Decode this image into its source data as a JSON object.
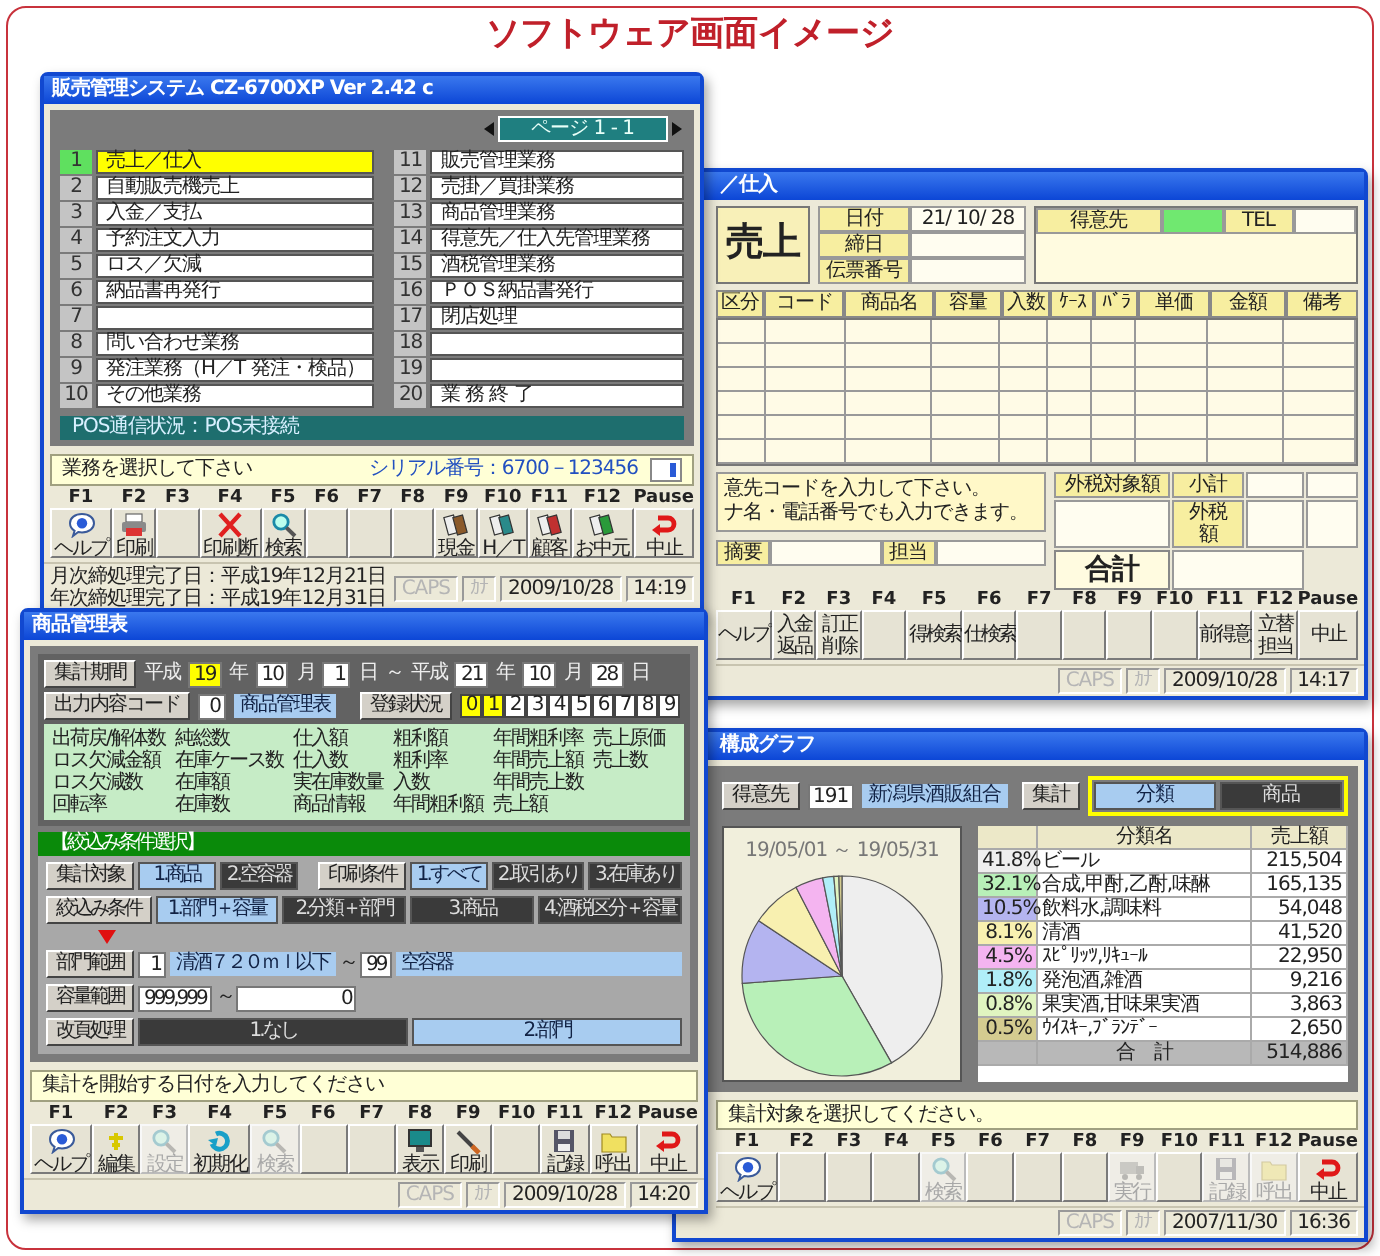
{
  "heading": "ソフトウェア画面イメージ",
  "windows": [
    {
      "kind": "menu",
      "title": "販売管理システム CZ-6700XP Ver 2.42 c",
      "page": "ページ 1 - 1",
      "items": [
        {
          "number": "1",
          "label": "売上／仕入",
          "selected": true
        },
        {
          "number": "2",
          "label": "自動販売機売上",
          "selected": false
        },
        {
          "number": "3",
          "label": "入金／支払",
          "selected": false
        },
        {
          "number": "4",
          "label": "予約注文入力",
          "selected": false
        },
        {
          "number": "5",
          "label": "ロス／欠減",
          "selected": false
        },
        {
          "number": "6",
          "label": "納品書再発行",
          "selected": false
        },
        {
          "number": "7",
          "selected": false
        },
        {
          "number": "8",
          "label": "問い合わせ業務",
          "selected": false
        },
        {
          "number": "9",
          "label": "発注業務（H／T 発注・検品）",
          "selected": false
        },
        {
          "number": "10",
          "label": "その他業務",
          "selected": false
        },
        {
          "number": "11",
          "label": "販売管理業務",
          "selected": false
        },
        {
          "number": "12",
          "label": "売掛／買掛業務",
          "selected": false
        },
        {
          "number": "13",
          "label": "商品管理業務",
          "selected": false
        },
        {
          "number": "14",
          "label": "得意先／仕入先管理業務",
          "selected": false
        },
        {
          "number": "15",
          "label": "酒税管理業務",
          "selected": false
        },
        {
          "number": "16",
          "label": "ＰＯＳ納品書発行",
          "selected": false
        },
        {
          "number": "17",
          "label": "閉店処理",
          "selected": false
        },
        {
          "number": "18",
          "selected": false
        },
        {
          "number": "19",
          "selected": false
        },
        {
          "number": "20",
          "label": "業 務 終 了",
          "selected": false
        }
      ],
      "pos_status": "POS通信状況：POS未接続",
      "prompt": "業務を選択して下さい",
      "serial": "シリアル番号：6700－123456",
      "fkeys": [
        {
          "key": "F1",
          "label": "ヘルプ",
          "kind": "help"
        },
        {
          "key": "F2",
          "label": "印刷",
          "kind": "print"
        },
        {
          "key": "F3"
        },
        {
          "key": "F4",
          "label": "印刷断",
          "kind": "cancel"
        },
        {
          "key": "F5",
          "label": "検索",
          "kind": "search"
        },
        {
          "key": "F6"
        },
        {
          "key": "F7"
        },
        {
          "key": "F8"
        },
        {
          "key": "F9",
          "label": "現金",
          "kind": "card",
          "color": "#8b5a2b"
        },
        {
          "key": "F10",
          "label": "H／T",
          "kind": "card",
          "color": "#2a8a8a"
        },
        {
          "key": "F11",
          "label": "顧客",
          "kind": "card",
          "color": "#c03030"
        },
        {
          "key": "F12",
          "label": "お中元",
          "kind": "card",
          "color": "#2a9a3a"
        },
        {
          "key": "Pause",
          "label": "中止",
          "kind": "stop"
        }
      ],
      "status_bar": {
        "messages": [
          "月次締処理完了日：平成19年12月21日",
          "年次締処理完了日：平成19年12月31日"
        ],
        "indicators": [
          {
            "text": "CAPS",
            "on": false
          },
          {
            "text": "ｶﾅ",
            "on": false
          },
          {
            "text": "2009/10/28",
            "on": true
          },
          {
            "text": "14:19",
            "on": true
          }
        ]
      }
    },
    {
      "kind": "sales",
      "title": "／仕入",
      "mode": "売上",
      "slip_fields": [
        {
          "label": "日付",
          "value": "21/ 10/ 28"
        },
        {
          "label": "締日"
        },
        {
          "label": "伝票番号"
        }
      ],
      "customer": {
        "label": "得意先",
        "focused": true,
        "tel_label": "TEL"
      },
      "columns": [
        "区分",
        "コード",
        "商品名",
        "容量",
        "入数",
        "ｹｰｽ",
        "ﾊﾞﾗ",
        "単価",
        "金額",
        "備考"
      ],
      "message": [
        "意先コードを入力して下さい。",
        "ナ名・電話番号でも入力できます。"
      ],
      "taxable_label": "外税対象額",
      "subtotal_label": "小計",
      "tax_label": "外税額",
      "total_label": "合計",
      "memo_label": "摘要",
      "staff_label": "担当",
      "fkeys": [
        {
          "key": "F1",
          "lines": [
            "ヘルプ"
          ]
        },
        {
          "key": "F2",
          "lines": [
            "入金",
            "返品"
          ]
        },
        {
          "key": "F3",
          "lines": [
            "訂正",
            "削除"
          ]
        },
        {
          "key": "F4"
        },
        {
          "key": "F5",
          "lines": [
            "得検索"
          ]
        },
        {
          "key": "F6",
          "lines": [
            "仕検索"
          ]
        },
        {
          "key": "F7"
        },
        {
          "key": "F8"
        },
        {
          "key": "F9"
        },
        {
          "key": "F10"
        },
        {
          "key": "F11",
          "lines": [
            "前得意"
          ]
        },
        {
          "key": "F12",
          "lines": [
            "立替",
            "担当"
          ]
        },
        {
          "key": "Pause",
          "lines": [
            "中止"
          ]
        }
      ],
      "status_bar": {
        "indicators": [
          {
            "text": "CAPS",
            "on": false
          },
          {
            "text": "ｶﾅ",
            "on": false
          },
          {
            "text": "2009/10/28",
            "on": true
          },
          {
            "text": "14:17",
            "on": true
          }
        ]
      }
    },
    {
      "kind": "report",
      "title": "商品管理表",
      "period": {
        "button": "集計期間",
        "parts": [
          {
            "kind": "text",
            "text": "平成"
          },
          {
            "kind": "field",
            "value": "19",
            "focused": true
          },
          {
            "kind": "text",
            "text": "年"
          },
          {
            "kind": "field",
            "value": "10",
            "focused": false
          },
          {
            "kind": "text",
            "text": "月"
          },
          {
            "kind": "field",
            "value": "1",
            "focused": false
          },
          {
            "kind": "text",
            "text": "日"
          },
          {
            "kind": "text",
            "text": "～"
          },
          {
            "kind": "text",
            "text": "平成"
          },
          {
            "kind": "field",
            "value": "21",
            "focused": false
          },
          {
            "kind": "text",
            "text": "年"
          },
          {
            "kind": "field",
            "value": "10",
            "focused": false
          },
          {
            "kind": "text",
            "text": "月"
          },
          {
            "kind": "field",
            "value": "28",
            "focused": false
          },
          {
            "kind": "text",
            "text": "日"
          }
        ]
      },
      "output": {
        "button": "出力内容コード",
        "code": "0",
        "name": "商品管理表"
      },
      "registration": {
        "button": "登録状況",
        "slots": [
          {
            "label": "0",
            "selected": true
          },
          {
            "label": "1",
            "selected": true
          },
          {
            "label": "2",
            "selected": false
          },
          {
            "label": "3",
            "selected": false
          },
          {
            "label": "4",
            "selected": false
          },
          {
            "label": "5",
            "selected": false
          },
          {
            "label": "6",
            "selected": false
          },
          {
            "label": "7",
            "selected": false
          },
          {
            "label": "8",
            "selected": false
          },
          {
            "label": "9",
            "selected": false
          }
        ]
      },
      "fields": [
        [
          "出荷戻/解体数",
          "ロス欠減金額",
          "ロス欠減数",
          "回転率"
        ],
        [
          "純総数",
          "在庫ケース数",
          "在庫額",
          "在庫数"
        ],
        [
          "仕入額",
          "仕入数",
          "実在庫数量",
          "商品情報"
        ],
        [
          "粗利額",
          "粗利率",
          "入数",
          "年間粗利額"
        ],
        [
          "年間粗利率",
          "年間売上額",
          "年間売上数",
          "売上額"
        ],
        [
          "売上原価",
          "売上数"
        ]
      ],
      "filter_heading": "【絞込み条件選択】",
      "rows": [
        {
          "kind": "options",
          "groups": [
            {
              "button": "集計対象",
              "options": [
                {
                  "label": "1.商品",
                  "selected": true
                },
                {
                  "label": "2.空容器",
                  "selected": false
                }
              ]
            },
            {
              "button": "印刷条件",
              "options": [
                {
                  "label": "1.すべて",
                  "selected": true
                },
                {
                  "label": "2.取引あり",
                  "selected": false
                },
                {
                  "label": "3.在庫あり",
                  "selected": false
                }
              ]
            }
          ]
        },
        {
          "kind": "options",
          "arrow_below": true,
          "groups": [
            {
              "button": "絞込み条件",
              "options": [
                {
                  "label": "1.部門＋容量",
                  "selected": true
                },
                {
                  "label": "2.分類＋部門",
                  "selected": false
                },
                {
                  "label": "3.商品",
                  "selected": false
                },
                {
                  "label": "4.酒税区分＋容量",
                  "selected": false
                }
              ]
            }
          ]
        },
        {
          "kind": "range",
          "button": "部門範囲",
          "from_code": "1",
          "from_name": "清酒７２０ｍｌ以下",
          "separator": "～",
          "to_code": "99",
          "to_name": "空容器"
        },
        {
          "kind": "range",
          "button": "容量範囲",
          "from_code": "999,999",
          "separator": "～",
          "to_code": "0"
        },
        {
          "kind": "options",
          "groups": [
            {
              "button": "改頁処理",
              "options": [
                {
                  "label": "1.なし",
                  "selected": false
                },
                {
                  "label": "2.部門",
                  "selected": true
                }
              ]
            }
          ]
        }
      ],
      "prompt": "集計を開始する日付を入力してください",
      "fkeys": [
        {
          "key": "F1",
          "label": "ヘルプ",
          "kind": "help",
          "disabled": false
        },
        {
          "key": "F2",
          "label": "編集",
          "kind": "plus",
          "disabled": false
        },
        {
          "key": "F3",
          "label": "設定",
          "kind": "search",
          "disabled": true
        },
        {
          "key": "F4",
          "label": "初期化",
          "kind": "refresh",
          "disabled": false
        },
        {
          "key": "F5",
          "label": "検索",
          "kind": "search",
          "disabled": true
        },
        {
          "key": "F6",
          "disabled": false
        },
        {
          "key": "F7",
          "disabled": false
        },
        {
          "key": "F8",
          "label": "表示",
          "kind": "monitor",
          "disabled": false
        },
        {
          "key": "F9",
          "label": "印刷",
          "kind": "pen",
          "disabled": false
        },
        {
          "key": "F10",
          "disabled": false
        },
        {
          "key": "F11",
          "label": "記録",
          "kind": "floppy",
          "disabled": false
        },
        {
          "key": "F12",
          "label": "呼出",
          "kind": "folder",
          "disabled": false
        },
        {
          "key": "Pause",
          "label": "中止",
          "kind": "stop",
          "disabled": false
        }
      ],
      "status_bar": {
        "indicators": [
          {
            "text": "CAPS",
            "on": false
          },
          {
            "text": "ｶﾅ",
            "on": false
          },
          {
            "text": "2009/10/28",
            "on": true
          },
          {
            "text": "14:20",
            "on": true
          }
        ]
      }
    },
    {
      "kind": "chart",
      "title": "構成グラフ",
      "customer": {
        "button": "得意先",
        "code": "191",
        "name": "新潟県酒販組合"
      },
      "summary": {
        "button": "集計",
        "options": [
          {
            "label": "分類",
            "selected": true
          },
          {
            "label": "商品",
            "selected": false
          }
        ]
      },
      "chart_data": {
        "type": "pie",
        "title": "19/05/01 ～ 19/05/31",
        "values": [
          41.8,
          32.1,
          10.5,
          8.1,
          4.5,
          1.8,
          0.8,
          0.5
        ]
      },
      "table": {
        "columns": [
          "分類名",
          "売上額"
        ],
        "rows": [
          {
            "share": "41.8%",
            "name": "ビール",
            "amount": "215,504",
            "color": "#eeeeee"
          },
          {
            "share": "32.1%",
            "name": "合成,甲酎,乙酎,味醂",
            "amount": "165,135",
            "color": "#b8f0b8"
          },
          {
            "share": "10.5%",
            "name": "飲料水,調味料",
            "amount": "54,048",
            "color": "#b4b4f0"
          },
          {
            "share": "8.1%",
            "name": "清酒",
            "amount": "41,520",
            "color": "#f8f0b0"
          },
          {
            "share": "4.5%",
            "name": "ｽﾋﾟﾘｯﾂ,ﾘｷｭｰﾙ",
            "amount": "22,950",
            "color": "#f4b4f0"
          },
          {
            "share": "1.8%",
            "name": "発泡酒,雑酒",
            "amount": "9,216",
            "color": "#b0eef8"
          },
          {
            "share": "0.8%",
            "name": "果実酒,甘味果実酒",
            "amount": "3,863",
            "color": "#e0f4c0"
          },
          {
            "share": "0.5%",
            "name": "ｳｲｽｷｰ,ﾌﾞﾗﾝﾃﾞｰ",
            "amount": "2,650",
            "color": "#d4cc90"
          }
        ],
        "total_label": "合　計",
        "total_amount": "514,886"
      },
      "prompt": "集計対象を選択してください。",
      "fkeys": [
        {
          "key": "F1",
          "label": "ヘルプ",
          "kind": "help",
          "disabled": false
        },
        {
          "key": "F2",
          "disabled": false
        },
        {
          "key": "F3",
          "disabled": false
        },
        {
          "key": "F4",
          "disabled": false
        },
        {
          "key": "F5",
          "label": "検索",
          "kind": "search",
          "disabled": true
        },
        {
          "key": "F6",
          "disabled": false
        },
        {
          "key": "F7",
          "disabled": false
        },
        {
          "key": "F8",
          "disabled": false
        },
        {
          "key": "F9",
          "label": "実行",
          "kind": "machine",
          "disabled": true
        },
        {
          "key": "F10",
          "disabled": false
        },
        {
          "key": "F11",
          "label": "記録",
          "kind": "floppy",
          "disabled": true
        },
        {
          "key": "F12",
          "label": "呼出",
          "kind": "folder",
          "disabled": true
        },
        {
          "key": "Pause",
          "label": "中止",
          "kind": "stop",
          "disabled": false
        }
      ],
      "status_bar": {
        "indicators": [
          {
            "text": "CAPS",
            "on": false
          },
          {
            "text": "ｶﾅ",
            "on": false
          },
          {
            "text": "2007/11/30",
            "on": true
          },
          {
            "text": "16:36",
            "on": true
          }
        ]
      }
    }
  ]
}
